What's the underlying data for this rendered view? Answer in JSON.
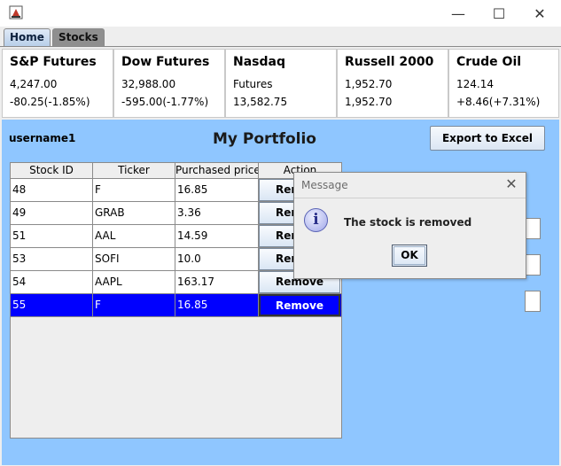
{
  "window": {
    "icon": "java-app-icon",
    "controls": {
      "minimize": "—",
      "maximize": "☐",
      "close": "✕"
    }
  },
  "tabs": [
    {
      "label": "Home",
      "active": true
    },
    {
      "label": "Stocks",
      "active": false
    }
  ],
  "tickers": [
    {
      "name": "S&P Futures",
      "line1": "4,247.00",
      "line2": "-80.25(-1.85%)"
    },
    {
      "name": "Dow Futures",
      "line1": "32,988.00",
      "line2": "-595.00(-1.77%)"
    },
    {
      "name": "Nasdaq",
      "line1": "Futures",
      "line2": "13,582.75"
    },
    {
      "name": "Russell 2000",
      "line1": "1,952.70",
      "line2": "1,952.70"
    },
    {
      "name": "Crude Oil",
      "line1": "124.14",
      "line2": "+8.46(+7.31%)"
    }
  ],
  "portfolio": {
    "username": "username1",
    "title": "My Portfolio",
    "export_label": "Export to Excel",
    "columns": [
      "Stock ID",
      "Ticker",
      "Purchased price",
      "Action"
    ],
    "rows": [
      {
        "id": "48",
        "ticker": "F",
        "price": "16.85",
        "action": "Remove",
        "selected": false
      },
      {
        "id": "49",
        "ticker": "GRAB",
        "price": "3.36",
        "action": "Remove",
        "selected": false
      },
      {
        "id": "51",
        "ticker": "AAL",
        "price": "14.59",
        "action": "Remove",
        "selected": false
      },
      {
        "id": "53",
        "ticker": "SOFI",
        "price": "10.0",
        "action": "Remove",
        "selected": false
      },
      {
        "id": "54",
        "ticker": "AAPL",
        "price": "163.17",
        "action": "Remove",
        "selected": false
      },
      {
        "id": "55",
        "ticker": "F",
        "price": "16.85",
        "action": "Remove",
        "selected": true
      }
    ]
  },
  "dialog": {
    "title": "Message",
    "close": "✕",
    "icon": "info-icon",
    "icon_glyph": "i",
    "message": "The stock is removed",
    "ok_label": "OK"
  },
  "colors": {
    "portfolio_bg": "#8fc6ff",
    "selection": "#0000ff"
  }
}
